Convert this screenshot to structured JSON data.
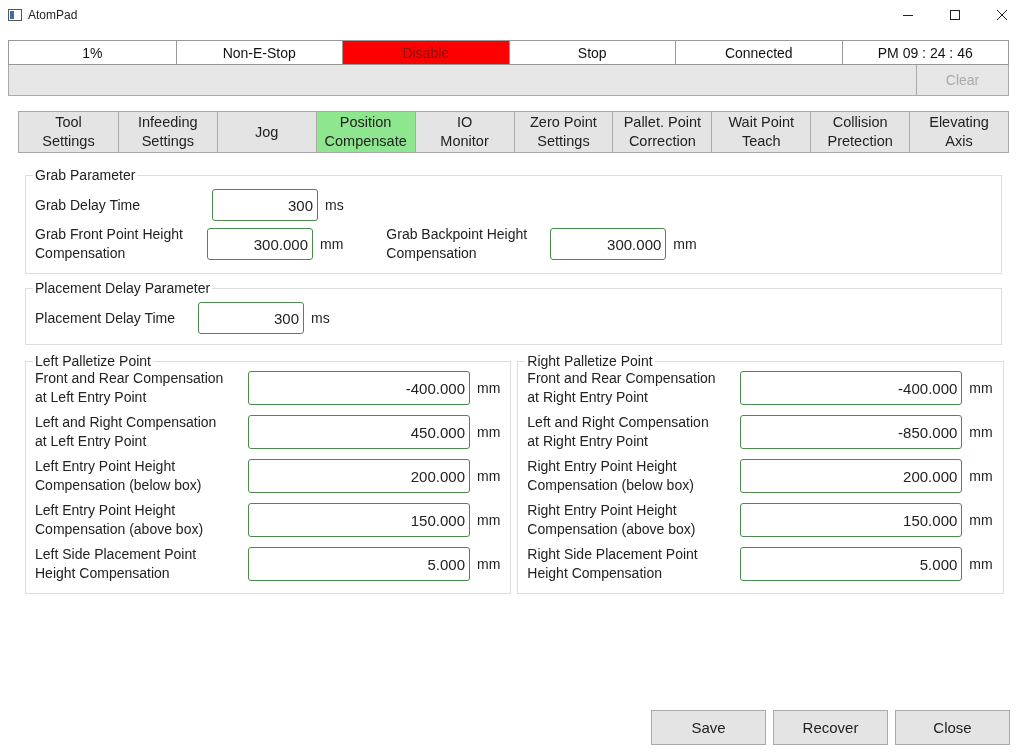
{
  "window": {
    "title": "AtomPad"
  },
  "status_bar": [
    {
      "text": "1%",
      "color": "#ffffff"
    },
    {
      "text": "Non-E-Stop",
      "color": "#ffffff"
    },
    {
      "text": "Disable",
      "color": "#ff0000"
    },
    {
      "text": "Stop",
      "color": "#ffffff"
    },
    {
      "text": "Connected",
      "color": "#ffffff"
    },
    {
      "text": "PM  09 : 24 : 46",
      "color": "#ffffff"
    }
  ],
  "message_bar": {
    "clear_button": {
      "label": "Clear",
      "disabled": true
    }
  },
  "tabs": [
    {
      "label": "Tool\nSettings",
      "selected": false
    },
    {
      "label": "Infeeding\nSettings",
      "selected": false
    },
    {
      "label": "Jog",
      "selected": false
    },
    {
      "label": "Position\nCompensate",
      "selected": true
    },
    {
      "label": "IO\nMonitor",
      "selected": false
    },
    {
      "label": "Zero Point\nSettings",
      "selected": false
    },
    {
      "label": "Pallet. Point\nCorrection",
      "selected": false
    },
    {
      "label": "Wait Point\nTeach",
      "selected": false
    },
    {
      "label": "Collision\nPretection",
      "selected": false
    },
    {
      "label": "Elevating\nAxis",
      "selected": false
    }
  ],
  "grab_parameter": {
    "title": "Grab Parameter",
    "rows": [
      [
        {
          "label": "Grab Delay Time",
          "value": "300",
          "unit": "ms"
        }
      ],
      [
        {
          "label": "Grab Front Point Height\nCompensation",
          "value": "300.000",
          "unit": "mm"
        },
        {
          "label": "Grab Backpoint Height\nCompensation",
          "value": "300.000",
          "unit": "mm"
        }
      ]
    ]
  },
  "placement_delay_parameter": {
    "title": "Placement Delay Parameter",
    "rows": [
      [
        {
          "label": "Placement Delay Time",
          "value": "300",
          "unit": "ms"
        }
      ]
    ]
  },
  "left_palletize_point": {
    "title": "Left Palletize Point",
    "fields": [
      {
        "label": "Front and Rear Compensation\nat Left Entry Point",
        "value": "-400.000",
        "unit": "mm"
      },
      {
        "label": "Left and Right Compensation\nat Left Entry Point",
        "value": "450.000",
        "unit": "mm"
      },
      {
        "label": "Left Entry Point Height\nCompensation (below box)",
        "value": "200.000",
        "unit": "mm"
      },
      {
        "label": "Left Entry Point Height\nCompensation (above box)",
        "value": "150.000",
        "unit": "mm"
      },
      {
        "label": "Left Side Placement Point\nHeight Compensation",
        "value": "5.000",
        "unit": "mm"
      }
    ]
  },
  "right_palletize_point": {
    "title": "Right Palletize Point",
    "fields": [
      {
        "label": "Front and Rear Compensation\nat Right Entry Point",
        "value": "-400.000",
        "unit": "mm"
      },
      {
        "label": "Left and Right Compensation\nat Right Entry Point",
        "value": "-850.000",
        "unit": "mm"
      },
      {
        "label": "Right Entry Point Height\nCompensation (below box)",
        "value": "200.000",
        "unit": "mm"
      },
      {
        "label": "Right Entry Point Height\nCompensation (above box)",
        "value": "150.000",
        "unit": "mm"
      },
      {
        "label": "Right Side Placement Point\n Height Compensation",
        "value": "5.000",
        "unit": "mm"
      }
    ]
  },
  "buttons": [
    "Save",
    "Recover",
    "Close"
  ]
}
